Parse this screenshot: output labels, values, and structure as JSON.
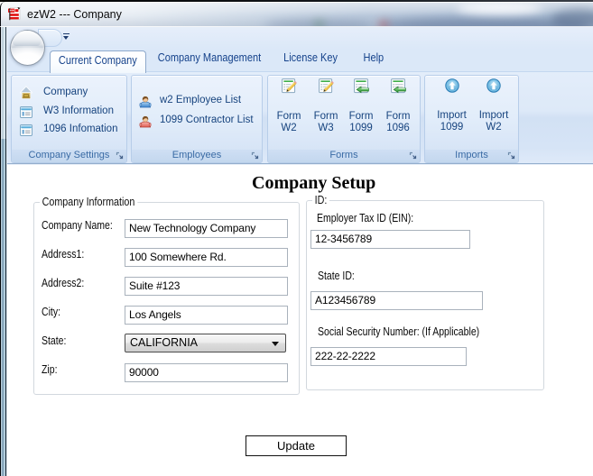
{
  "window": {
    "title": "ezW2 --- Company"
  },
  "tabs": [
    {
      "label": "Current Company",
      "active": true
    },
    {
      "label": "Company Management",
      "active": false
    },
    {
      "label": "License Key",
      "active": false
    },
    {
      "label": "Help",
      "active": false
    }
  ],
  "ribbon": {
    "groups": [
      {
        "caption": "Company Settings",
        "items": [
          {
            "label": "Company",
            "icon": "house-icon"
          },
          {
            "label": "W3 Information",
            "icon": "form-window-icon"
          },
          {
            "label": "1096 Infomation",
            "icon": "form-window-icon"
          }
        ]
      },
      {
        "caption": "Employees",
        "items": [
          {
            "label": "w2 Employee List",
            "icon": "person-blue-icon"
          },
          {
            "label": "1099 Contractor List",
            "icon": "person-red-icon"
          }
        ]
      },
      {
        "caption": "Forms",
        "items": [
          {
            "label": "Form",
            "label2": "W2",
            "icon": "form-edit-icon"
          },
          {
            "label": "Form",
            "label2": "W3",
            "icon": "form-edit-icon"
          },
          {
            "label": "Form",
            "label2": "1099",
            "icon": "form-import-arrow-icon"
          },
          {
            "label": "Form",
            "label2": "1096",
            "icon": "form-import-arrow-icon"
          }
        ]
      },
      {
        "caption": "Imports",
        "items": [
          {
            "label": "Import",
            "label2": "1099",
            "icon": "import-up-icon"
          },
          {
            "label": "Import",
            "label2": "W2",
            "icon": "import-up-icon"
          }
        ]
      }
    ]
  },
  "content": {
    "heading": "Company Setup",
    "company_info": {
      "legend": "Company Information",
      "fields": [
        {
          "label": "Company Name:",
          "value": "New Technology Company"
        },
        {
          "label": "Address1:",
          "value": "100 Somewhere Rd."
        },
        {
          "label": "Address2:",
          "value": "Suite #123"
        },
        {
          "label": "City:",
          "value": "Los Angels"
        },
        {
          "label": "State:",
          "value": "CALIFORNIA"
        },
        {
          "label": "Zip:",
          "value": "90000"
        }
      ]
    },
    "id_section": {
      "legend": "ID:",
      "fields": [
        {
          "label": "Employer Tax ID (EIN):",
          "value": "12-3456789"
        },
        {
          "label": "State ID:",
          "value": "A123456789"
        },
        {
          "label": "Social Security Number: (If Applicable)",
          "value": "222-22-2222"
        }
      ]
    },
    "update_label": "Update"
  },
  "colors": {
    "ribbon_text": "#16437e",
    "tab_text": "#15428b",
    "caption_text": "#3a6ba5",
    "accent_red": "#e01010"
  }
}
